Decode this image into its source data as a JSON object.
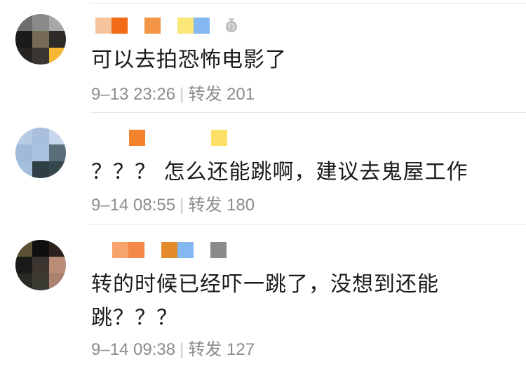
{
  "comments": [
    {
      "text": "可以去拍恐怖电影了",
      "timestamp": "9–13 23:26",
      "repost_label": "转发",
      "repost_count": "201"
    },
    {
      "text": "？？？ 怎么还能跳啊，建议去鬼屋工作",
      "timestamp": "9–14 08:55",
      "repost_label": "转发",
      "repost_count": "180"
    },
    {
      "text": "转的时候已经吓一跳了，没想到还能跳？？？",
      "timestamp": "9–14 09:38",
      "repost_label": "转发",
      "repost_count": "127"
    }
  ],
  "text_lines": {
    "c3_line1": "转的时候已经吓一跳了，没想到还能",
    "c3_line2": "跳？？？"
  },
  "colors": {
    "text": "#1a1a1a",
    "meta": "#8c8c8c",
    "divider": "#e6e6e6"
  },
  "icons": {
    "medal": "medal-icon"
  }
}
